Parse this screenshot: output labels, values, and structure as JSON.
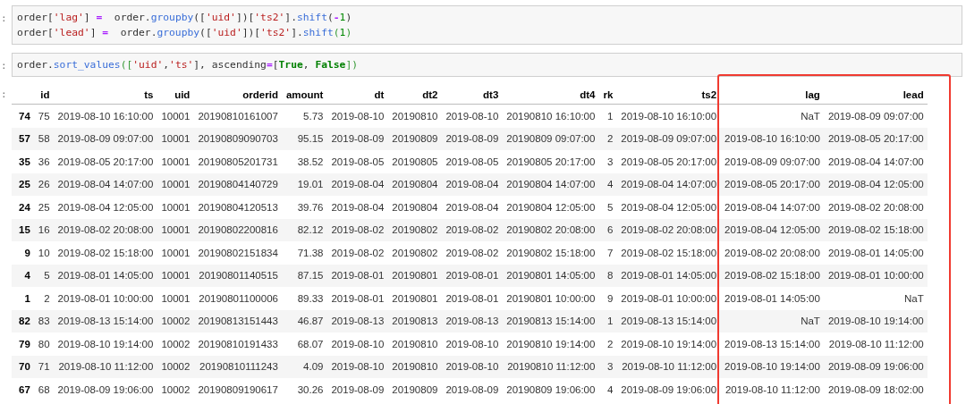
{
  "cells": [
    {
      "prompt": ":",
      "lines": [
        [
          {
            "kind": "var",
            "text": "order["
          },
          {
            "kind": "str",
            "text": "'lag'"
          },
          {
            "kind": "var",
            "text": "] "
          },
          {
            "kind": "op",
            "text": "="
          },
          {
            "kind": "var",
            "text": "  order."
          },
          {
            "kind": "attr",
            "text": "groupby"
          },
          {
            "kind": "var",
            "text": "(["
          },
          {
            "kind": "str",
            "text": "'uid'"
          },
          {
            "kind": "var",
            "text": "])["
          },
          {
            "kind": "str",
            "text": "'ts2'"
          },
          {
            "kind": "var",
            "text": "]."
          },
          {
            "kind": "attr",
            "text": "shift"
          },
          {
            "kind": "var",
            "text": "("
          },
          {
            "kind": "op",
            "text": "-"
          },
          {
            "kind": "num",
            "text": "1"
          },
          {
            "kind": "var",
            "text": ")"
          }
        ],
        [
          {
            "kind": "var",
            "text": "order["
          },
          {
            "kind": "str",
            "text": "'lead'"
          },
          {
            "kind": "var",
            "text": "] "
          },
          {
            "kind": "op",
            "text": "="
          },
          {
            "kind": "var",
            "text": "  order."
          },
          {
            "kind": "attr",
            "text": "groupby"
          },
          {
            "kind": "var",
            "text": "(["
          },
          {
            "kind": "str",
            "text": "'uid'"
          },
          {
            "kind": "var",
            "text": "])["
          },
          {
            "kind": "str",
            "text": "'ts2'"
          },
          {
            "kind": "var",
            "text": "]."
          },
          {
            "kind": "attr",
            "text": "shift"
          },
          {
            "kind": "punct",
            "text": "("
          },
          {
            "kind": "num",
            "text": "1"
          },
          {
            "kind": "punct",
            "text": ")"
          }
        ]
      ]
    },
    {
      "prompt": ":",
      "lines": [
        [
          {
            "kind": "var",
            "text": "order."
          },
          {
            "kind": "attr",
            "text": "sort_values"
          },
          {
            "kind": "punct",
            "text": "(["
          },
          {
            "kind": "str",
            "text": "'uid'"
          },
          {
            "kind": "var",
            "text": ","
          },
          {
            "kind": "str",
            "text": "'ts'"
          },
          {
            "kind": "var",
            "text": "], ascending"
          },
          {
            "kind": "op",
            "text": "="
          },
          {
            "kind": "var",
            "text": "["
          },
          {
            "kind": "kw",
            "text": "True"
          },
          {
            "kind": "var",
            "text": ", "
          },
          {
            "kind": "kw",
            "text": "False"
          },
          {
            "kind": "punct",
            "text": "])"
          }
        ]
      ]
    }
  ],
  "output": {
    "prompt": ":",
    "table": {
      "columns": [
        {
          "label": "id",
          "highlighted": false
        },
        {
          "label": "ts",
          "highlighted": false
        },
        {
          "label": "uid",
          "highlighted": false
        },
        {
          "label": "orderid",
          "highlighted": false
        },
        {
          "label": "amount",
          "highlighted": false
        },
        {
          "label": "dt",
          "highlighted": false
        },
        {
          "label": "dt2",
          "highlighted": false
        },
        {
          "label": "dt3",
          "highlighted": false
        },
        {
          "label": "dt4",
          "highlighted": false
        },
        {
          "label": "rk",
          "highlighted": false
        },
        {
          "label": "ts2",
          "highlighted": false
        },
        {
          "label": "lag",
          "highlighted": true
        },
        {
          "label": "lead",
          "highlighted": true
        }
      ],
      "rows": [
        {
          "index": "74",
          "cells": [
            "75",
            "2019-08-10 16:10:00",
            "10001",
            "20190810161007",
            "5.73",
            "2019-08-10",
            "20190810",
            "2019-08-10",
            "20190810 16:10:00",
            "1",
            "2019-08-10 16:10:00",
            "NaT",
            "2019-08-09 09:07:00"
          ]
        },
        {
          "index": "57",
          "cells": [
            "58",
            "2019-08-09 09:07:00",
            "10001",
            "20190809090703",
            "95.15",
            "2019-08-09",
            "20190809",
            "2019-08-09",
            "20190809 09:07:00",
            "2",
            "2019-08-09 09:07:00",
            "2019-08-10 16:10:00",
            "2019-08-05 20:17:00"
          ]
        },
        {
          "index": "35",
          "cells": [
            "36",
            "2019-08-05 20:17:00",
            "10001",
            "20190805201731",
            "38.52",
            "2019-08-05",
            "20190805",
            "2019-08-05",
            "20190805 20:17:00",
            "3",
            "2019-08-05 20:17:00",
            "2019-08-09 09:07:00",
            "2019-08-04 14:07:00"
          ]
        },
        {
          "index": "25",
          "cells": [
            "26",
            "2019-08-04 14:07:00",
            "10001",
            "20190804140729",
            "19.01",
            "2019-08-04",
            "20190804",
            "2019-08-04",
            "20190804 14:07:00",
            "4",
            "2019-08-04 14:07:00",
            "2019-08-05 20:17:00",
            "2019-08-04 12:05:00"
          ]
        },
        {
          "index": "24",
          "cells": [
            "25",
            "2019-08-04 12:05:00",
            "10001",
            "20190804120513",
            "39.76",
            "2019-08-04",
            "20190804",
            "2019-08-04",
            "20190804 12:05:00",
            "5",
            "2019-08-04 12:05:00",
            "2019-08-04 14:07:00",
            "2019-08-02 20:08:00"
          ]
        },
        {
          "index": "15",
          "cells": [
            "16",
            "2019-08-02 20:08:00",
            "10001",
            "20190802200816",
            "82.12",
            "2019-08-02",
            "20190802",
            "2019-08-02",
            "20190802 20:08:00",
            "6",
            "2019-08-02 20:08:00",
            "2019-08-04 12:05:00",
            "2019-08-02 15:18:00"
          ]
        },
        {
          "index": "9",
          "cells": [
            "10",
            "2019-08-02 15:18:00",
            "10001",
            "20190802151834",
            "71.38",
            "2019-08-02",
            "20190802",
            "2019-08-02",
            "20190802 15:18:00",
            "7",
            "2019-08-02 15:18:00",
            "2019-08-02 20:08:00",
            "2019-08-01 14:05:00"
          ]
        },
        {
          "index": "4",
          "cells": [
            "5",
            "2019-08-01 14:05:00",
            "10001",
            "20190801140515",
            "87.15",
            "2019-08-01",
            "20190801",
            "2019-08-01",
            "20190801 14:05:00",
            "8",
            "2019-08-01 14:05:00",
            "2019-08-02 15:18:00",
            "2019-08-01 10:00:00"
          ]
        },
        {
          "index": "1",
          "cells": [
            "2",
            "2019-08-01 10:00:00",
            "10001",
            "20190801100006",
            "89.33",
            "2019-08-01",
            "20190801",
            "2019-08-01",
            "20190801 10:00:00",
            "9",
            "2019-08-01 10:00:00",
            "2019-08-01 14:05:00",
            "NaT"
          ]
        },
        {
          "index": "82",
          "cells": [
            "83",
            "2019-08-13 15:14:00",
            "10002",
            "20190813151443",
            "46.87",
            "2019-08-13",
            "20190813",
            "2019-08-13",
            "20190813 15:14:00",
            "1",
            "2019-08-13 15:14:00",
            "NaT",
            "2019-08-10 19:14:00"
          ]
        },
        {
          "index": "79",
          "cells": [
            "80",
            "2019-08-10 19:14:00",
            "10002",
            "20190810191433",
            "68.07",
            "2019-08-10",
            "20190810",
            "2019-08-10",
            "20190810 19:14:00",
            "2",
            "2019-08-10 19:14:00",
            "2019-08-13 15:14:00",
            "2019-08-10 11:12:00"
          ]
        },
        {
          "index": "70",
          "cells": [
            "71",
            "2019-08-10 11:12:00",
            "10002",
            "20190810111243",
            "4.09",
            "2019-08-10",
            "20190810",
            "2019-08-10",
            "20190810 11:12:00",
            "3",
            "2019-08-10 11:12:00",
            "2019-08-10 19:14:00",
            "2019-08-09 19:06:00"
          ]
        },
        {
          "index": "67",
          "cells": [
            "68",
            "2019-08-09 19:06:00",
            "10002",
            "20190809190617",
            "30.26",
            "2019-08-09",
            "20190809",
            "2019-08-09",
            "20190809 19:06:00",
            "4",
            "2019-08-09 19:06:00",
            "2019-08-10 11:12:00",
            "2019-08-09 18:02:00"
          ]
        }
      ]
    }
  }
}
